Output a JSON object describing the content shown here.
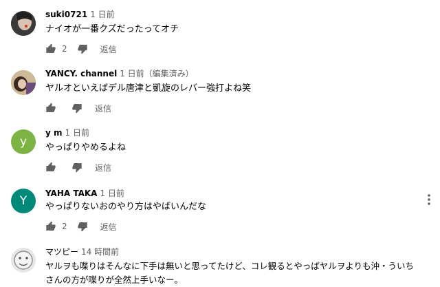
{
  "colors": {
    "y_m_avatar": "#7cb342",
    "yaha_avatar": "#00897b",
    "meta_text": "#606060"
  },
  "comments": [
    {
      "author": "suki0721",
      "time": "1 日前",
      "text": "ナイオが一番クズだったってオチ",
      "likes": "2",
      "reply_label": "返信"
    },
    {
      "author": "YANCY. channel",
      "time": "1 日前（編集済み）",
      "text": "ヤルオといえばデル唐津と凱旋のレバー強打よね笑",
      "likes": "",
      "reply_label": "返信"
    },
    {
      "author": "y m",
      "avatar_letter": "y",
      "time": "1 日前",
      "text": "やっぱりやめるよね",
      "likes": "",
      "reply_label": "返信"
    },
    {
      "author": "YAHA TAKA",
      "avatar_letter": "Y",
      "time": "1 日前",
      "text": "やっぱりないおのやり方はやばいんだな",
      "likes": "2",
      "reply_label": "返信"
    },
    {
      "author": "マツピー",
      "time": "14 時間前",
      "text_line1": "ヤルヲも喋りはそんなに下手は無いと思ってたけど、コレ観るとやっぱヤルヲよりも沖・ういち",
      "text_line2": "さんの方が喋りが全然上手いなー。"
    }
  ]
}
